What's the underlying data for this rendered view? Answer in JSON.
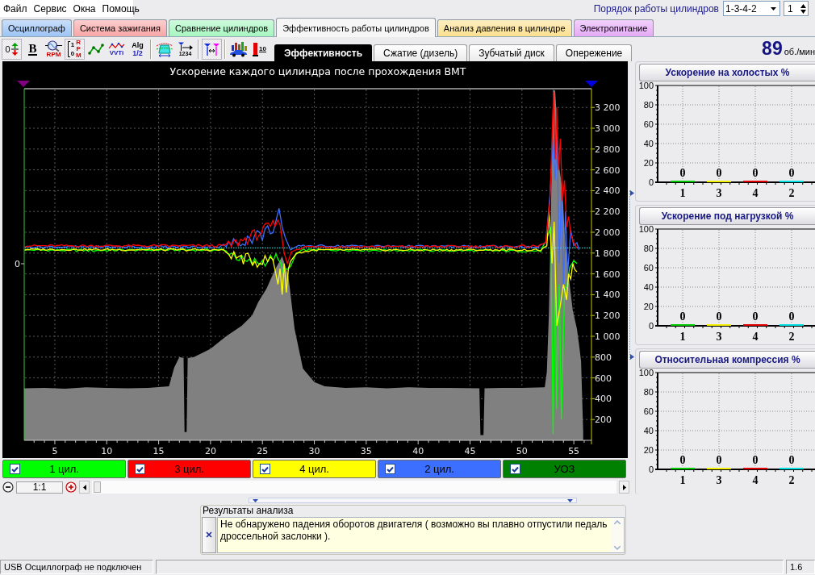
{
  "menu": [
    {
      "label": "Файл"
    },
    {
      "label": "Сервис"
    },
    {
      "label": "Окна"
    },
    {
      "label": "Помощь"
    }
  ],
  "firing_order": {
    "label": "Порядок работы цилиндров",
    "value": "1-3-4-2",
    "spinner_value": "1"
  },
  "tabs": [
    {
      "label": "Осциллограф",
      "color": "#9dc4f6",
      "selected": false
    },
    {
      "label": "Система зажигания",
      "color": "#f8a6a6",
      "selected": false
    },
    {
      "label": "Сравнение цилиндров",
      "color": "#a6f6c0",
      "selected": false
    },
    {
      "label": "Эффективность работы цилиндров",
      "color": "#f6f6f6",
      "selected": true
    },
    {
      "label": "Анализ давления в цилиндре",
      "color": "#fbe08e",
      "selected": false
    },
    {
      "label": "Электропитание",
      "color": "#e5aaf6",
      "selected": false
    }
  ],
  "toolbar": [
    {
      "items": [
        {
          "kind": "offset",
          "texts": [
            "0"
          ],
          "on": true
        },
        {
          "kind": "bold",
          "texts": [
            "B"
          ],
          "on": false
        },
        {
          "kind": "rpm-scope",
          "texts": [
            "RPM"
          ],
          "on": false
        },
        {
          "kind": "rpm-scale",
          "texts": [
            "1",
            "0",
            "RPM"
          ],
          "on": true
        },
        {
          "kind": "line",
          "on": false
        },
        {
          "kind": "vvti",
          "texts": [
            "VVTi"
          ],
          "on": false
        },
        {
          "kind": "alg",
          "texts": [
            "Alg",
            "1/2"
          ],
          "on": false
        }
      ]
    },
    {
      "items": [
        {
          "kind": "cylinder",
          "on": false
        },
        {
          "kind": "order",
          "texts": [
            "1234"
          ],
          "on": false
        }
      ]
    },
    {
      "items": [
        {
          "kind": "spacing",
          "on": true
        }
      ]
    },
    {
      "items": [
        {
          "kind": "car-chart",
          "on": false
        },
        {
          "kind": "bar-10",
          "texts": [
            "10"
          ],
          "on": false
        }
      ]
    }
  ],
  "subtabs": [
    {
      "label": "Эффективность",
      "selected": true
    },
    {
      "label": "Сжатие (дизель)",
      "selected": false
    },
    {
      "label": "Зубчатый диск",
      "selected": false
    },
    {
      "label": "Опережение",
      "selected": false
    }
  ],
  "rpm": {
    "value": "89",
    "unit": "об./мин"
  },
  "main_chart": {
    "left_axis_tick": "0",
    "chart_data": {
      "type": "area",
      "title": "Ускорение каждого цилиндра после прохождения ВМТ",
      "x": [
        2.05,
        4,
        6,
        8,
        10,
        12,
        14,
        16,
        16.5,
        17,
        17.4,
        17.5,
        17.7,
        17.8,
        18.4,
        20,
        21.5,
        23,
        24,
        24.6,
        25.4,
        26.2,
        26.9,
        27.5,
        28.1,
        28.9,
        30,
        31,
        33,
        35,
        37,
        39,
        41,
        43,
        45.9,
        46,
        46.3,
        46.4,
        48,
        50,
        52.2,
        52.4,
        52.6,
        52.8,
        53,
        53.2,
        53.4,
        53.6,
        53.9,
        54.1,
        54.5,
        54.9,
        55.3,
        55.5,
        55.7,
        55.9
      ],
      "series": [
        {
          "color": "#808080",
          "values": [
            500,
            505,
            495,
            510,
            505,
            500,
            505,
            520,
            700,
            800,
            790,
            80,
            80,
            790,
            800,
            880,
            1000,
            1100,
            1200,
            1330,
            1460,
            1640,
            1770,
            1580,
            1070,
            690,
            560,
            520,
            505,
            510,
            500,
            510,
            505,
            505,
            500,
            50,
            50,
            500,
            505,
            505,
            510,
            660,
            1230,
            2230,
            3370,
            3360,
            3030,
            2620,
            2410,
            2000,
            1580,
            1250,
            1070,
            920,
            760,
            90
          ]
        }
      ],
      "xlim": [
        2.05,
        56.7
      ],
      "ylim": [
        0,
        3380
      ],
      "xticks": [
        5,
        10,
        15,
        20,
        25,
        30,
        35,
        40,
        45,
        50,
        55
      ],
      "yticks": [
        {
          "value": 200,
          "label": "200"
        },
        {
          "value": 400,
          "label": "400"
        },
        {
          "value": 600,
          "label": "600"
        },
        {
          "value": 800,
          "label": "800"
        },
        {
          "value": 1000,
          "label": "1 000"
        },
        {
          "value": 1200,
          "label": "1 200"
        },
        {
          "value": 1400,
          "label": "1 400"
        },
        {
          "value": 1600,
          "label": "1 600"
        },
        {
          "value": 1800,
          "label": "1 800"
        },
        {
          "value": 2000,
          "label": "2 000"
        },
        {
          "value": 2200,
          "label": "2 200"
        },
        {
          "value": 2400,
          "label": "2 400"
        },
        {
          "value": 2600,
          "label": "2 600"
        },
        {
          "value": 2800,
          "label": "2 800"
        },
        {
          "value": 3000,
          "label": "3 000"
        },
        {
          "value": 3200,
          "label": "3 200"
        }
      ],
      "grid": true
    }
  },
  "legend": [
    {
      "label": "1 цил.",
      "color": "#00ff00",
      "checked": true
    },
    {
      "label": "3 цил.",
      "color": "#ff0000",
      "checked": true
    },
    {
      "label": "4 цил.",
      "color": "#ffff00",
      "checked": true
    },
    {
      "label": "2 цил.",
      "color": "#3c6eff",
      "checked": true
    },
    {
      "label": "УОЗ",
      "color": "#008000",
      "checked": true
    }
  ],
  "zoom": {
    "value": "1:1"
  },
  "results": {
    "title": "Результаты анализа",
    "text": "Не обнаружено падения оборотов двигателя ( возможно вы плавно отпустили педаль дроссельной заслонки )."
  },
  "right_panels": [
    {
      "chart_data": {
        "type": "bar",
        "title": "Ускорение на холостых %",
        "categories": [
          "1",
          "3",
          "4",
          "2"
        ],
        "values": [
          0,
          0,
          0,
          0
        ],
        "colors": [
          "#00c800",
          "#f0f000",
          "#e00000",
          "#00e0e0"
        ],
        "ylim": [
          0,
          100
        ],
        "yticks": [
          0,
          20,
          40,
          60,
          80,
          100
        ],
        "data_labels": true,
        "grid": true
      }
    },
    {
      "chart_data": {
        "type": "bar",
        "title": "Ускорение под нагрузкой %",
        "categories": [
          "1",
          "3",
          "4",
          "2"
        ],
        "values": [
          0,
          0,
          0,
          0
        ],
        "colors": [
          "#00c800",
          "#f0f000",
          "#e00000",
          "#00e0e0"
        ],
        "ylim": [
          0,
          100
        ],
        "yticks": [
          0,
          20,
          40,
          60,
          80,
          100
        ],
        "data_labels": true,
        "grid": true
      }
    },
    {
      "chart_data": {
        "type": "bar",
        "title": "Относительная компрессия %",
        "categories": [
          "1",
          "3",
          "4",
          "2"
        ],
        "values": [
          0,
          0,
          0,
          0
        ],
        "colors": [
          "#00c800",
          "#f0f000",
          "#e00000",
          "#00e0e0"
        ],
        "ylim": [
          0,
          100
        ],
        "yticks": [
          0,
          20,
          40,
          60,
          80,
          100
        ],
        "data_labels": true,
        "grid": true
      }
    }
  ],
  "status_bar": {
    "message": "USB Осциллограф не подключен",
    "version": "1.6"
  }
}
